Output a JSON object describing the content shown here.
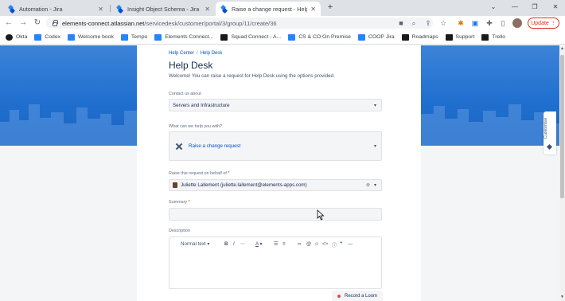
{
  "browser": {
    "tabs": [
      {
        "title": "Automation - Jira",
        "active": false
      },
      {
        "title": "Insight Object Schema - Jira",
        "active": false
      },
      {
        "title": "Raise a change request - Help De",
        "active": true
      }
    ],
    "new_tab": "+",
    "window_controls": [
      "⌄",
      "—",
      "❐",
      "✕"
    ],
    "url_host": "elements-connect.atlassian.net",
    "url_path": "/servicedesk/customer/portal/3/group/11/create/36",
    "update_label": "Update",
    "bookmarks": [
      {
        "label": "Okta",
        "color": "#1a1a1a"
      },
      {
        "label": "Codex",
        "color": "#2684ff"
      },
      {
        "label": "Welcome book",
        "color": "#2684ff"
      },
      {
        "label": "Tempo",
        "color": "#2684ff"
      },
      {
        "label": "Elements Connect...",
        "color": "#2684ff"
      },
      {
        "label": "Squad Connect - A...",
        "color": "#1a1a1a"
      },
      {
        "label": "CS & CO On Premise",
        "color": "#2684ff"
      },
      {
        "label": "COOP Jira",
        "color": "#2684ff"
      },
      {
        "label": "Roadmaps",
        "color": "#1a1a1a"
      },
      {
        "label": "Support",
        "color": "#1a1a1a"
      },
      {
        "label": "Trello",
        "color": "#1a1a1a"
      }
    ]
  },
  "portal": {
    "breadcrumb": [
      "Help Center",
      "Help Desk"
    ],
    "title": "Help Desk",
    "subtitle": "Welcome! You can raise a request for Help Desk using the options provided.",
    "contact_label": "Contact us about",
    "contact_value": "Servers and Infrastructure",
    "help_label": "What can we help you with?",
    "request_type": "Raise a change request",
    "behalf_label": "Raise this request on behalf of",
    "behalf_value": "Juliette Lallement (juliette.lallement@elements-apps.com)",
    "summary_label": "Summary",
    "description_label": "Description",
    "editor_text_style": "Normal text",
    "loom_label": "Record a Loom",
    "customise_label": "Customise",
    "required_mark": "*"
  },
  "colors": {
    "brand_blue": "#0052cc",
    "banner_blue": "#2070d0",
    "required_red": "#de350b"
  }
}
